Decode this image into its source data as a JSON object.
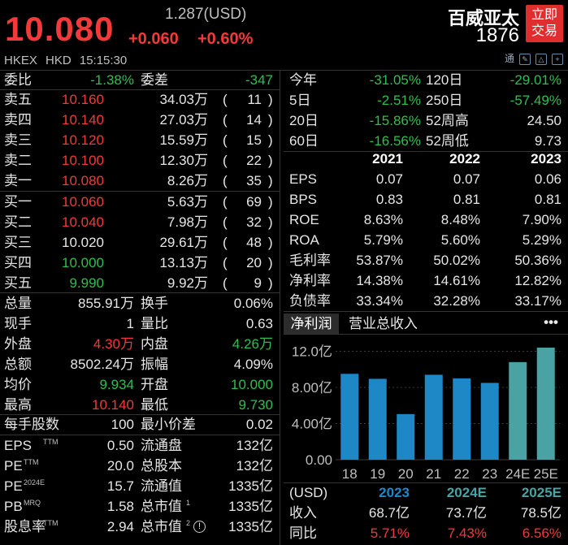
{
  "header": {
    "price": "10.080",
    "usd": "1.287(USD)",
    "change": "+0.060",
    "change_pct": "+0.60%",
    "name": "百威亚太",
    "code": "1876",
    "trade_btn_l1": "立即",
    "trade_btn_l2": "交易",
    "market": "HKEX HKD 15:15:30",
    "icon_tong": "通"
  },
  "colors": {
    "up": "#f23a3a",
    "down": "#2fbf4f",
    "bar_reported": "#1e88c6",
    "bar_estimate": "#4aa3a3",
    "trade_btn": "#e02e2e"
  },
  "weibi": {
    "label": "委比",
    "value": "-1.38%",
    "diff_label": "委差",
    "diff_value": "-347"
  },
  "asks": [
    {
      "label": "卖五",
      "price": "10.160",
      "vol": "34.03万",
      "lp": "(",
      "cnt": "11",
      "rp": ")"
    },
    {
      "label": "卖四",
      "price": "10.140",
      "vol": "27.03万",
      "lp": "(",
      "cnt": "14",
      "rp": ")"
    },
    {
      "label": "卖三",
      "price": "10.120",
      "vol": "15.59万",
      "lp": "(",
      "cnt": "15",
      "rp": ")"
    },
    {
      "label": "卖二",
      "price": "10.100",
      "vol": "12.30万",
      "lp": "(",
      "cnt": "22",
      "rp": ")"
    },
    {
      "label": "卖一",
      "price": "10.080",
      "vol": "8.26万",
      "lp": "(",
      "cnt": "35",
      "rp": ")"
    }
  ],
  "bids": [
    {
      "label": "买一",
      "price": "10.060",
      "vol": "5.63万",
      "lp": "(",
      "cnt": "69",
      "rp": ")"
    },
    {
      "label": "买二",
      "price": "10.040",
      "vol": "7.98万",
      "lp": "(",
      "cnt": "32",
      "rp": ")"
    },
    {
      "label": "买三",
      "price": "10.020",
      "vol": "29.61万",
      "lp": "(",
      "cnt": "48",
      "rp": ")"
    },
    {
      "label": "买四",
      "price": "10.000",
      "vol": "13.13万",
      "lp": "(",
      "cnt": "20",
      "rp": ")"
    },
    {
      "label": "买五",
      "price": "9.990",
      "vol": "9.92万",
      "lp": "(",
      "cnt": "9",
      "rp": ")"
    }
  ],
  "stats": [
    {
      "l1": "总量",
      "v1": "855.91万",
      "l2": "换手",
      "v2": "0.06%"
    },
    {
      "l1": "现手",
      "v1": "1",
      "l2": "量比",
      "v2": "0.63"
    },
    {
      "l1": "外盘",
      "v1": "4.30万",
      "l2": "内盘",
      "v2": "4.26万"
    },
    {
      "l1": "总额",
      "v1": "8502.24万",
      "l2": "振幅",
      "v2": "4.09%"
    },
    {
      "l1": "均价",
      "v1": "9.934",
      "l2": "开盘",
      "v2": "10.000"
    },
    {
      "l1": "最高",
      "v1": "10.140",
      "l2": "最低",
      "v2": "9.730"
    }
  ],
  "lot": {
    "l1": "每手股数",
    "v1": "100",
    "l2": "最小价差",
    "v2": "0.02"
  },
  "valuation": [
    {
      "l1": "EPS",
      "s1": "TTM",
      "v1": "0.50",
      "l2": "流通盘",
      "s2": "",
      "v2": "132亿"
    },
    {
      "l1": "PE",
      "s1": "TTM",
      "v1": "20.0",
      "l2": "总股本",
      "s2": "",
      "v2": "132亿"
    },
    {
      "l1": "PE",
      "s1": "2024E",
      "v1": "15.7",
      "l2": "流通值",
      "s2": "",
      "v2": "1335亿"
    },
    {
      "l1": "PB",
      "s1": "MRQ",
      "v1": "1.58",
      "l2": "总市值",
      "s2": "1",
      "v2": "1335亿"
    },
    {
      "l1": "股息率",
      "s1": "TTM",
      "v1": "2.94",
      "l2": "总市值",
      "s2": "2",
      "v2": "1335亿"
    }
  ],
  "perf": [
    {
      "l1": "今年",
      "v1": "-31.05%",
      "l2": "120日",
      "v2": "-29.01%"
    },
    {
      "l1": "5日",
      "v1": "-2.51%",
      "l2": "250日",
      "v2": "-57.49%"
    },
    {
      "l1": "20日",
      "v1": "-15.86%",
      "l2": "52周高",
      "v2": "24.50"
    },
    {
      "l1": "60日",
      "v1": "-16.56%",
      "l2": "52周低",
      "v2": "9.73"
    }
  ],
  "fin": {
    "years": [
      "2021",
      "2022",
      "2023"
    ],
    "rows": [
      {
        "label": "EPS",
        "vals": [
          "0.07",
          "0.07",
          "0.06"
        ]
      },
      {
        "label": "BPS",
        "vals": [
          "0.83",
          "0.81",
          "0.81"
        ]
      },
      {
        "label": "ROE",
        "vals": [
          "8.63%",
          "8.48%",
          "7.90%"
        ]
      },
      {
        "label": "ROA",
        "vals": [
          "5.79%",
          "5.60%",
          "5.29%"
        ]
      },
      {
        "label": "毛利率",
        "vals": [
          "53.87%",
          "50.02%",
          "50.36%"
        ]
      },
      {
        "label": "净利率",
        "vals": [
          "14.38%",
          "14.61%",
          "12.82%"
        ]
      },
      {
        "label": "负债率",
        "vals": [
          "33.34%",
          "32.28%",
          "33.17%"
        ]
      }
    ]
  },
  "tabs": {
    "net": "净利润",
    "rev": "营业总收入",
    "more": "•••"
  },
  "chart_data": {
    "type": "bar",
    "categories": [
      "18",
      "19",
      "20",
      "21",
      "22",
      "23",
      "24E",
      "25E"
    ],
    "values": [
      9.5,
      8.95,
      5.05,
      9.4,
      9.0,
      8.5,
      10.8,
      12.4
    ],
    "estimate": [
      false,
      false,
      false,
      false,
      false,
      false,
      true,
      true
    ],
    "yticks": [
      "12.0亿",
      "8.00亿",
      "4.00亿",
      "0.00"
    ],
    "ytick_values": [
      12,
      8,
      4,
      0
    ],
    "ylim": [
      0,
      13.3
    ],
    "unit": "亿"
  },
  "forecast": {
    "head": "(USD)",
    "years": [
      "2023",
      "2024E",
      "2025E"
    ],
    "rows": [
      {
        "label": "收入",
        "vals": [
          "68.7亿",
          "73.7亿",
          "78.5亿"
        ]
      },
      {
        "label": "同比",
        "vals": [
          "5.71%",
          "7.43%",
          "6.56%"
        ]
      }
    ]
  }
}
